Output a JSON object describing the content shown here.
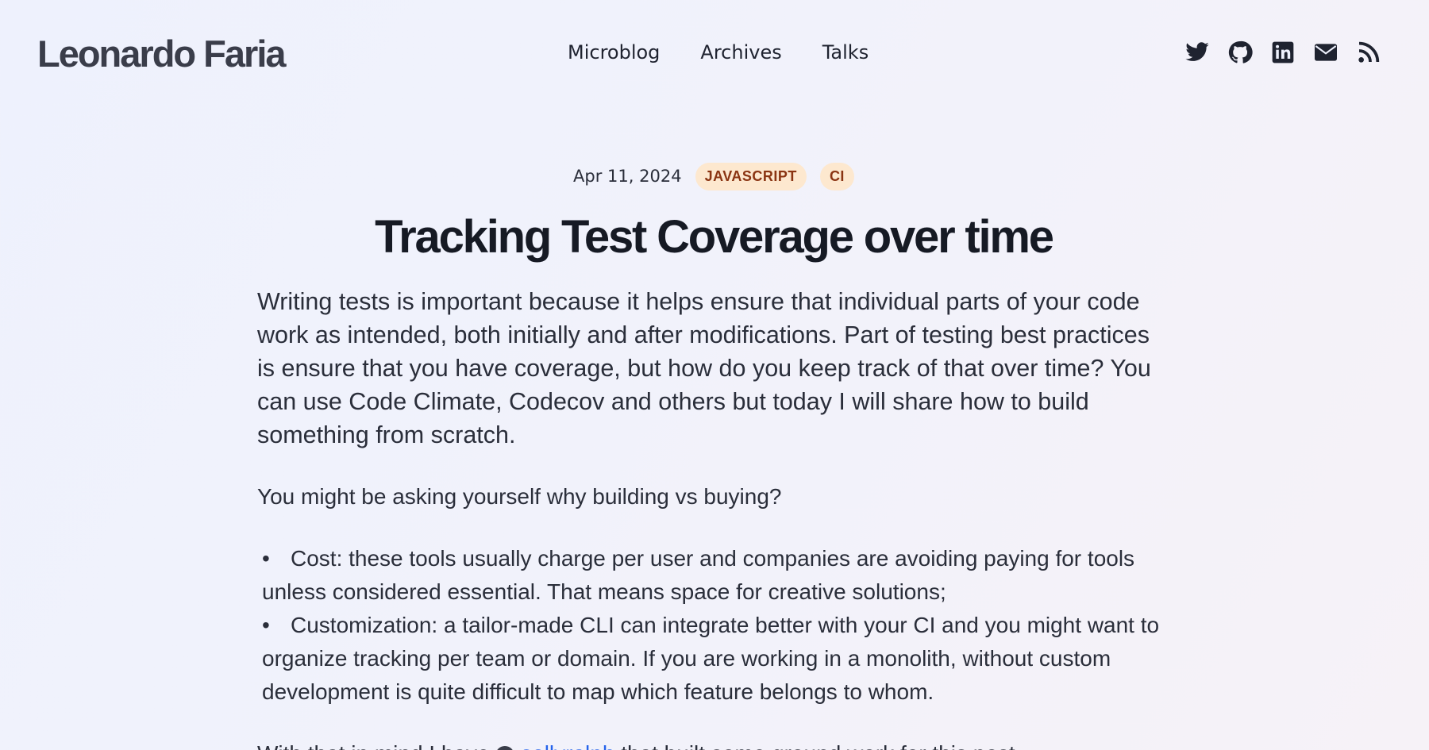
{
  "header": {
    "brand": "Leonardo Faria",
    "nav": [
      {
        "label": "Microblog"
      },
      {
        "label": "Archives"
      },
      {
        "label": "Talks"
      }
    ],
    "social": [
      {
        "icon": "twitter-icon"
      },
      {
        "icon": "github-icon"
      },
      {
        "icon": "linkedin-icon"
      },
      {
        "icon": "email-icon"
      },
      {
        "icon": "rss-icon"
      }
    ]
  },
  "article": {
    "date": "Apr 11, 2024",
    "tags": [
      "JAVASCRIPT",
      "CI"
    ],
    "title": "Tracking Test Coverage over time",
    "lead": "Writing tests is important because it helps ensure that individual parts of your code work as intended, both initially and after modifications. Part of testing best practices is ensure that you have coverage, but how do you keep track of that over time? You can use Code Climate, Codecov and others but today I will share how to build something from scratch.",
    "question": "You might be asking yourself why building vs buying?",
    "bullets": [
      "Cost: these tools usually charge per user and companies are avoiding paying for tools unless considered essential. That means space for creative solutions;",
      "Customization: a tailor-made CLI can integrate better with your CI and you might want to organize tracking per team or domain. If you are working in a monolith, without custom development is quite difficult to map which feature belongs to whom."
    ],
    "cut_line_start": "With that in mind I have",
    "cut_line_link": "sollyralph",
    "cut_line_end": "that built some ground work for this post"
  },
  "colors": {
    "tag_bg": "#fde8cf",
    "tag_text": "#8a3412",
    "link": "#2563eb"
  }
}
